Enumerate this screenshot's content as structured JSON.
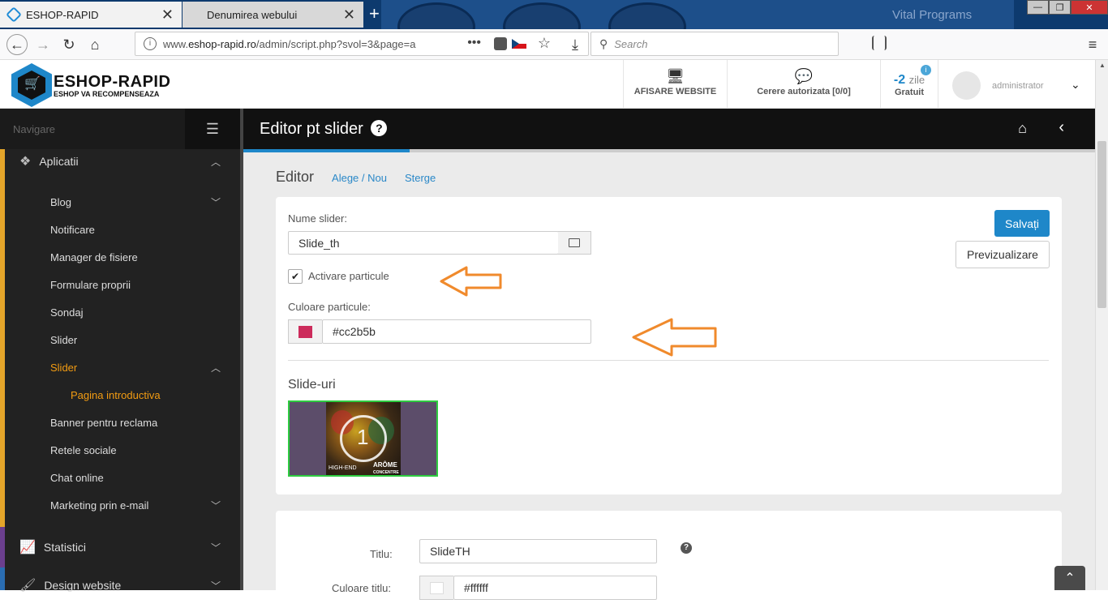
{
  "browser": {
    "tabs": [
      {
        "title": "ESHOP-RAPID",
        "close": "✕"
      },
      {
        "title": "Denumirea webului",
        "close": "✕"
      }
    ],
    "new_tab": "+",
    "bg_watermark": "Vital Programs",
    "window_controls": [
      "—",
      "❐",
      "✕"
    ],
    "url_prefix": "www.",
    "url_domain": "eshop-rapid.ro",
    "url_rest": "/admin/script.php?svol=3&page=a",
    "url_more": "•••",
    "search_placeholder": "Search",
    "search_icon": "⚲",
    "nav_icons": {
      "back": "←",
      "forward": "→",
      "reload": "↻",
      "home": "⌂",
      "star": "☆",
      "download": "⤓",
      "menu": "≡"
    },
    "extension_colors": [
      "#555555",
      "#555555",
      "#e8a800",
      "#d3121a",
      "#555555",
      "#b35a1a",
      "#39a339",
      "#999999"
    ]
  },
  "header": {
    "logo_title": "ESHOP-RAPID",
    "logo_subtitle": "ESHOP VA RECOMPENSEAZA",
    "website_label": "AFISARE WEBSITE",
    "requests_label": "Cerere autorizata [0/0]",
    "days_value": "-2",
    "days_unit": "zile",
    "days_plan": "Gratuit",
    "info_badge": "i",
    "username": "administrator",
    "caret": "⌄"
  },
  "sidebar": {
    "nav_title": "Navigare",
    "hamburger": "☰",
    "items": [
      {
        "label": "Aplicatii",
        "icon": "cubes-icon",
        "chev": "︿"
      },
      {
        "label": "Blog",
        "chev": "﹀"
      },
      {
        "label": "Notificare"
      },
      {
        "label": "Manager de fisiere"
      },
      {
        "label": "Formulare proprii"
      },
      {
        "label": "Sondaj"
      },
      {
        "label": "Slider"
      },
      {
        "label": "Slider",
        "chev": "︿"
      },
      {
        "label": "Pagina introductiva"
      },
      {
        "label": "Banner pentru reclama"
      },
      {
        "label": "Retele sociale"
      },
      {
        "label": "Chat online"
      },
      {
        "label": "Marketing prin e-mail",
        "chev": "﹀"
      },
      {
        "label": "Statistici",
        "icon": "line-chart-icon",
        "chev": "﹀"
      },
      {
        "label": "Design website",
        "icon": "brush-icon",
        "chev": "﹀"
      }
    ]
  },
  "page": {
    "title": "Editor pt slider",
    "title_help": "?",
    "home_icon": "⌂",
    "back_icon": "‹",
    "editor_label": "Editor",
    "link_choose": "Alege / Nou",
    "link_delete": "Sterge"
  },
  "slider_form": {
    "name_label": "Nume slider:",
    "name_value": "Slide_th",
    "particles_label": "Activare particule",
    "particles_checked": true,
    "check_mark": "✔",
    "color_label": "Culoare particule:",
    "color_value": "#cc2b5b",
    "save_button": "Salvați",
    "preview_button": "Previzualizare",
    "slides_title": "Slide-uri",
    "slide_number": "1",
    "slide_brand": "ARÔME",
    "slide_brand2": "CONCENTRE",
    "slide_brand3": "HIGH-END",
    "annotation_color": "#f08a2c"
  },
  "slide_form": {
    "title_label": "Titlu:",
    "title_value": "SlideTH",
    "help": "?",
    "title_color_label": "Culoare titlu:",
    "title_color_value": "#ffffff"
  },
  "scroll_top": "⌃"
}
